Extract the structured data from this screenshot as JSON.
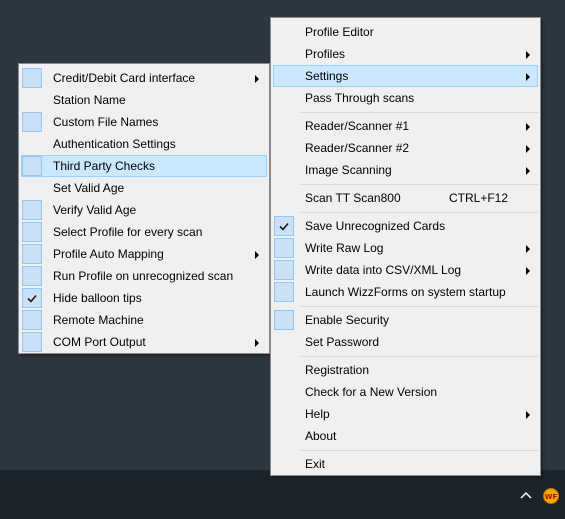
{
  "left_menu": {
    "items": [
      {
        "label": "Credit/Debit Card interface",
        "checkbox": true,
        "checked": false,
        "submenu": true,
        "highlighted": false
      },
      {
        "label": "Station Name",
        "checkbox": false,
        "checked": false,
        "submenu": false,
        "highlighted": false
      },
      {
        "label": "Custom File Names",
        "checkbox": true,
        "checked": false,
        "submenu": false,
        "highlighted": false
      },
      {
        "label": "Authentication Settings",
        "checkbox": false,
        "checked": false,
        "submenu": false,
        "highlighted": false
      },
      {
        "label": "Third Party Checks",
        "checkbox": true,
        "checked": false,
        "submenu": false,
        "highlighted": true
      },
      {
        "label": "Set Valid Age",
        "checkbox": false,
        "checked": false,
        "submenu": false,
        "highlighted": false
      },
      {
        "label": "Verify Valid Age",
        "checkbox": true,
        "checked": false,
        "submenu": false,
        "highlighted": false
      },
      {
        "label": "Select Profile for every scan",
        "checkbox": true,
        "checked": false,
        "submenu": false,
        "highlighted": false
      },
      {
        "label": "Profile Auto Mapping",
        "checkbox": true,
        "checked": false,
        "submenu": true,
        "highlighted": false
      },
      {
        "label": "Run Profile on unrecognized scan",
        "checkbox": true,
        "checked": false,
        "submenu": false,
        "highlighted": false
      },
      {
        "label": "Hide balloon tips",
        "checkbox": true,
        "checked": true,
        "submenu": false,
        "highlighted": false
      },
      {
        "label": "Remote Machine",
        "checkbox": true,
        "checked": false,
        "submenu": false,
        "highlighted": false
      },
      {
        "label": "COM Port Output",
        "checkbox": true,
        "checked": false,
        "submenu": true,
        "highlighted": false
      }
    ]
  },
  "main_menu": {
    "items": [
      {
        "label": "Profile Editor",
        "shortcut": "",
        "checkbox": false,
        "checked": false,
        "submenu": false,
        "highlighted": false
      },
      {
        "label": "Profiles",
        "shortcut": "",
        "checkbox": false,
        "checked": false,
        "submenu": true,
        "highlighted": false
      },
      {
        "label": "Settings",
        "shortcut": "",
        "checkbox": false,
        "checked": false,
        "submenu": true,
        "highlighted": true
      },
      {
        "label": "Pass Through scans",
        "shortcut": "",
        "checkbox": false,
        "checked": false,
        "submenu": false,
        "highlighted": false
      },
      {
        "separator": true
      },
      {
        "label": "Reader/Scanner #1",
        "shortcut": "",
        "checkbox": false,
        "checked": false,
        "submenu": true,
        "highlighted": false
      },
      {
        "label": "Reader/Scanner #2",
        "shortcut": "",
        "checkbox": false,
        "checked": false,
        "submenu": true,
        "highlighted": false
      },
      {
        "label": "Image Scanning",
        "shortcut": "",
        "checkbox": false,
        "checked": false,
        "submenu": true,
        "highlighted": false
      },
      {
        "separator": true
      },
      {
        "label": "Scan TT Scan800",
        "shortcut": "CTRL+F12",
        "checkbox": false,
        "checked": false,
        "submenu": false,
        "highlighted": false
      },
      {
        "separator": true
      },
      {
        "label": "Save Unrecognized Cards",
        "shortcut": "",
        "checkbox": true,
        "checked": true,
        "submenu": false,
        "highlighted": false
      },
      {
        "label": "Write Raw Log",
        "shortcut": "",
        "checkbox": true,
        "checked": false,
        "submenu": true,
        "highlighted": false
      },
      {
        "label": "Write data into CSV/XML Log",
        "shortcut": "",
        "checkbox": true,
        "checked": false,
        "submenu": true,
        "highlighted": false
      },
      {
        "label": "Launch WizzForms on system startup",
        "shortcut": "",
        "checkbox": true,
        "checked": false,
        "submenu": false,
        "highlighted": false
      },
      {
        "separator": true
      },
      {
        "label": "Enable Security",
        "shortcut": "",
        "checkbox": true,
        "checked": false,
        "submenu": false,
        "highlighted": false
      },
      {
        "label": "Set Password",
        "shortcut": "",
        "checkbox": false,
        "checked": false,
        "submenu": false,
        "highlighted": false
      },
      {
        "separator": true
      },
      {
        "label": "Registration",
        "shortcut": "",
        "checkbox": false,
        "checked": false,
        "submenu": false,
        "highlighted": false
      },
      {
        "label": "Check for a New Version",
        "shortcut": "",
        "checkbox": false,
        "checked": false,
        "submenu": false,
        "highlighted": false
      },
      {
        "label": "Help",
        "shortcut": "",
        "checkbox": false,
        "checked": false,
        "submenu": true,
        "highlighted": false
      },
      {
        "label": "About",
        "shortcut": "",
        "checkbox": false,
        "checked": false,
        "submenu": false,
        "highlighted": false
      },
      {
        "separator": true
      },
      {
        "label": "Exit",
        "shortcut": "",
        "checkbox": false,
        "checked": false,
        "submenu": false,
        "highlighted": false
      }
    ]
  },
  "taskbar": {
    "tray_icon_label": "WF",
    "show_hidden_icons": "chevron-up-icon",
    "tray_app_icon": "wizzforms-tray-icon"
  },
  "colors": {
    "desktop": "#2d3741",
    "taskbar": "#1c2329",
    "menu_bg": "#f0f0f0",
    "highlight": "#cce8ff",
    "checkbox_bg": "#c9e0f7"
  }
}
